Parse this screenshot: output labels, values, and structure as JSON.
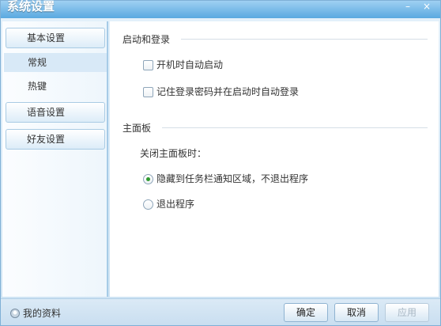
{
  "window": {
    "title": "系统设置",
    "minimize_glyph": "–",
    "close_glyph": "×"
  },
  "sidebar": {
    "groups": [
      {
        "label": "基本设置"
      },
      {
        "label": "语音设置"
      },
      {
        "label": "好友设置"
      }
    ],
    "sub_items": [
      {
        "label": "常规",
        "selected": true
      },
      {
        "label": "热键",
        "selected": false
      }
    ]
  },
  "content": {
    "sections": [
      {
        "title": "启动和登录",
        "options": [
          {
            "type": "checkbox",
            "label": "开机时自动启动",
            "checked": false
          },
          {
            "type": "checkbox",
            "label": "记住登录密码并在启动时自动登录",
            "checked": false
          }
        ]
      },
      {
        "title": "主面板",
        "prompt": "关闭主面板时：",
        "options": [
          {
            "type": "radio",
            "label": "隐藏到任务栏通知区域，不退出程序",
            "checked": true
          },
          {
            "type": "radio",
            "label": "退出程序",
            "checked": false
          }
        ]
      }
    ]
  },
  "footer": {
    "profile_label": "我的资料",
    "buttons": {
      "ok": "确定",
      "cancel": "取消",
      "apply": "应用"
    }
  },
  "colors": {
    "accent": "#5aa9e0",
    "radio_checked": "#2f9a2f",
    "disabled_text": "#a7b6c3"
  },
  "icons": {
    "profile": "user-icon"
  }
}
